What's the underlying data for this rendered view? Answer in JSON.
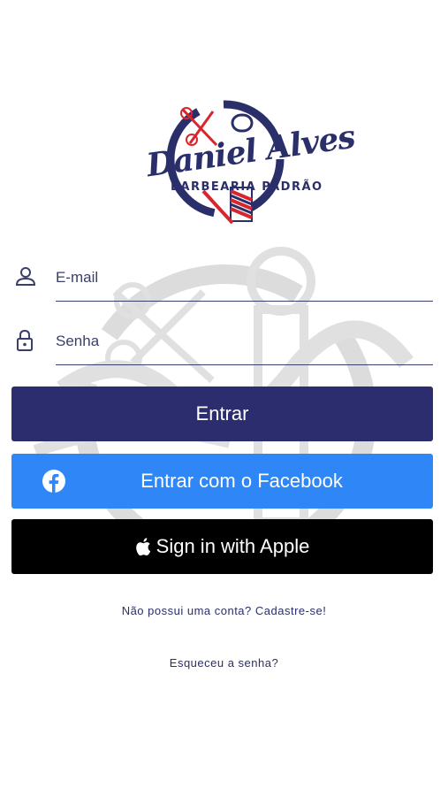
{
  "logo": {
    "script_text": "Daniel Alves",
    "subtitle": "BARBEARIA PADRÃO"
  },
  "form": {
    "email": {
      "placeholder": "E-mail",
      "icon": "person-icon"
    },
    "password": {
      "placeholder": "Senha",
      "icon": "lock-icon"
    }
  },
  "buttons": {
    "login": "Entrar",
    "facebook": "Entrar com o Facebook",
    "apple": "Sign in with Apple"
  },
  "links": {
    "signup": "Não possui uma conta? Cadastre-se!",
    "forgot": "Esqueceu a senha?"
  },
  "colors": {
    "primary": "#2b2d6e",
    "facebook": "#2f86f6",
    "apple": "#000000",
    "barber_red": "#d8262f"
  }
}
